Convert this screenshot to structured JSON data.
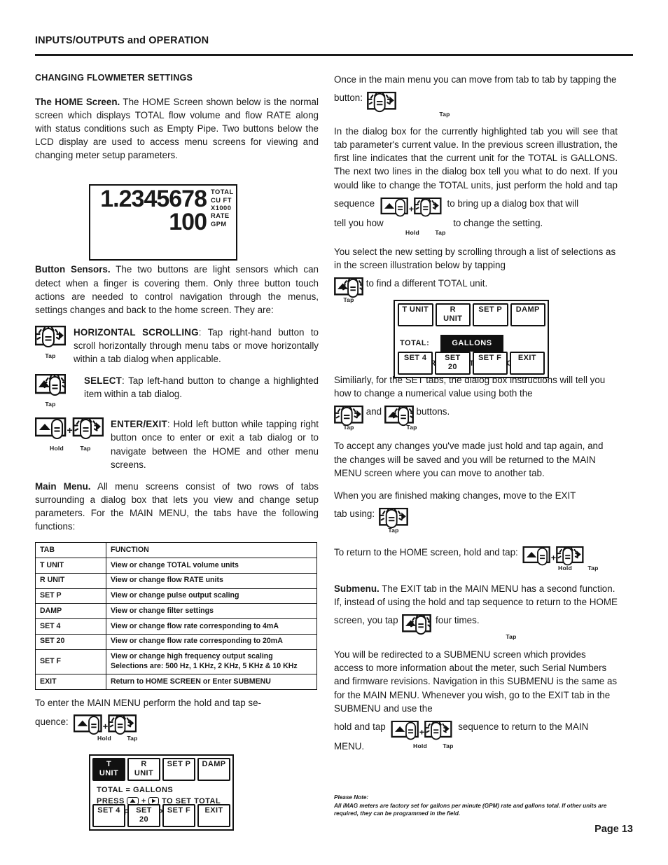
{
  "header": {
    "title": "INPUTS/OUTPUTS and OPERATION"
  },
  "left_column": {
    "section_title": "CHANGING FLOWMETER SETTINGS",
    "home_screen": {
      "lead": "The HOME Screen.",
      "text": "The HOME Screen shown below is the normal screen which displays TOTAL flow volume and flow RATE along with status conditions such as Empty Pipe. Two buttons below the LCD display are used to access menu screens for viewing and changing meter setup parameters."
    },
    "lcd": {
      "total_value": "1.2345678",
      "total_unit_line1": "TOTAL",
      "total_unit_line2": "CU FT",
      "total_unit_line3": "X1000",
      "rate_value": "100",
      "rate_unit_line1": "RATE",
      "rate_unit_line2": "GPM"
    },
    "button_sensors": {
      "lead": "Button Sensors.",
      "text": "The two buttons are light sensors which can detect when a finger is covering them. Only three button touch actions are needed to control navigation through the menus, settings changes and back to the home screen. They are:"
    },
    "actions": [
      {
        "name": "HORIZONTAL SCROLLING",
        "text": ": Tap right-hand button to scroll horizontally through menu tabs or move horizontally within a tab dialog when applicable.",
        "icon": "right-button-tap-icon",
        "caption": "Tap"
      },
      {
        "name": "SELECT",
        "text": ": Tap left-hand button to change a highlighted item within a tab dialog.",
        "icon": "left-button-tap-icon",
        "caption": "Tap"
      },
      {
        "name": "ENTER/EXIT",
        "text": ": Hold left button while tapping right button once to enter or exit a tab dialog or to navigate between the HOME and  other menu screens.",
        "icon": "hold-and-tap-icon",
        "caption_hold": "Hold",
        "caption_tap": "Tap"
      }
    ],
    "main_menu": {
      "lead": "Main Menu.",
      "text": "All menu screens consist of two rows of tabs surrounding a dialog box that lets you view and change setup parameters. For the MAIN MENU, the tabs have the following functions:"
    },
    "table": {
      "headers": [
        "TAB",
        "FUNCTION"
      ],
      "rows": [
        [
          "T UNIT",
          "View or change TOTAL volume units"
        ],
        [
          "R UNIT",
          "View or change flow RATE units"
        ],
        [
          "SET P",
          "View or change pulse output scaling"
        ],
        [
          "DAMP",
          "View or change filter settings"
        ],
        [
          "SET 4",
          "View or change flow rate corresponding to 4mA"
        ],
        [
          "SET 20",
          "View or change flow rate corresponding to 20mA"
        ],
        [
          "SET F",
          "View or change high frequency output scaling\nSelections are: 500 Hz, 1 KHz, 2 KHz, 5 KHz & 10 KHz"
        ],
        [
          "EXIT",
          "Return to HOME SCREEN or Enter SUBMENU"
        ]
      ]
    },
    "enter_menu": {
      "text_a": "To enter the MAIN MENU perform the hold and tap se-",
      "text_b": "quence:",
      "caption_hold": "Hold",
      "caption_tap": "Tap"
    },
    "menu_screen_1": {
      "top_tabs": [
        "T UNIT",
        "R UNIT",
        "SET P",
        "DAMP"
      ],
      "top_tab_selected": 0,
      "dialog_line1": "TOTAL = GALLONS",
      "dialog_line2_a": "PRESS",
      "dialog_line2_b": "+",
      "dialog_line2_c": "TO SET TOTAL",
      "dialog_line3": "UNITS FOR DISPLAY",
      "bottom_tabs": [
        "SET 4",
        "SET 20",
        "SET F",
        "EXIT"
      ]
    }
  },
  "right_column": {
    "para_tab_to_tab": "Once in the main menu you can move from tab to tab by tapping the button:",
    "tap_caption_1": "Tap",
    "para_dialog_a": "In the dialog box for the currently highlighted tab you will see that tab parameter's current value. In the previous screen illustration, the first line indicates that the current unit for the TOTAL is GALLONS. The next two lines in the dialog box tell you what to do next. If you would like to change the TOTAL units, just perform the hold and tap",
    "para_dialog_seq_word": "sequence",
    "para_dialog_b": "to bring up a dialog box that will",
    "para_dialog_c": "tell you how",
    "para_dialog_d": "to change the setting.",
    "hold_caption_2": "Hold",
    "tap_caption_2": "Tap",
    "para_select_a": "You select the new setting by scrolling through a list of selections as in the screen illustration below by tapping",
    "para_select_b": "to find a different TOTAL unit.",
    "tap_caption_3": "Tap",
    "menu_screen_2": {
      "top_tabs": [
        "T UNIT",
        "R UNIT",
        "SET P",
        "DAMP"
      ],
      "top_tab_selected": -1,
      "dialog_label": "TOTAL:",
      "dialog_value": "GALLONS",
      "dialog_instruction_a": "PRESS",
      "dialog_instruction_b": "TO CHANGE",
      "bottom_tabs": [
        "SET 4",
        "SET 20",
        "SET F",
        "EXIT"
      ]
    },
    "para_set_tabs_a": "Similiarly, for the SET tabs, the dialog box instructions will tell you how to change a numerical value using both the",
    "para_set_tabs_and": "and",
    "para_set_tabs_b": "buttons.",
    "tap_caption_4": "Tap",
    "tap_caption_5": "Tap",
    "para_accept": "To accept any changes you've made just hold and tap again, and the changes will be saved and you will be returned to the MAIN MENU screen where you can move to another tab.",
    "para_exit_a": "When you are finished making changes, move to the EXIT",
    "para_exit_b": "tab using:",
    "tap_caption_6": "Tap",
    "para_home_return": "To return to the HOME screen, hold and tap:",
    "hold_caption_7": "Hold",
    "tap_caption_7": "Tap",
    "submenu": {
      "lead": "Submenu.",
      "text_a": "The EXIT tab in the MAIN MENU has a second function. If, instead of using the hold and tap sequence to return to the HOME screen, you tap",
      "text_b": "four times.",
      "tap_caption": "Tap"
    },
    "para_redirect_a": "You will be redirected to a SUBMENU screen which provides access to more information about the meter, such Serial Numbers and firmware revisions. Navigation in this SUBMENU is the same as for the MAIN MENU. Whenever you wish, go to the EXIT tab in the SUBMENU and use the",
    "para_redirect_b": "hold and tap",
    "para_redirect_c": "sequence to return to the MAIN",
    "para_redirect_d": "MENU.",
    "hold_caption_8": "Hold",
    "tap_caption_8": "Tap"
  },
  "footer": {
    "note_title": "Please Note:",
    "note_body": "All iMAG meters are factory set for gallons per minute (GPM) rate and gallons total.  If other units are required, they can be programmed in the field.",
    "page_label": "Page 13"
  }
}
